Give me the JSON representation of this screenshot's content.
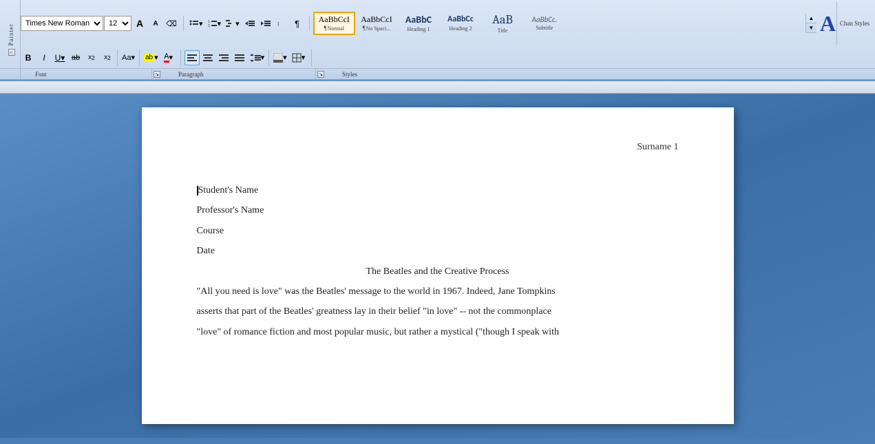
{
  "toolbar": {
    "font": {
      "name": "Times New Roman",
      "size": "12",
      "grow_label": "A",
      "shrink_label": "A",
      "clear_label": "⌫"
    },
    "formatting": {
      "bold": "B",
      "italic": "I",
      "underline": "U",
      "strikethrough": "ab",
      "subscript": "x₂",
      "superscript": "x²",
      "case": "Aa",
      "highlight_label": "ab",
      "color_label": "A"
    },
    "paragraph": {
      "list_bullets": "≡",
      "list_numbers": "≡",
      "multilevel": "≡",
      "decrease_indent": "⇐",
      "increase_indent": "⇒",
      "sort": "↕",
      "show_marks": "¶",
      "align_left": "≡",
      "align_center": "≡",
      "align_right": "≡",
      "align_justify": "≡",
      "line_spacing": "≡",
      "shading": "░",
      "borders": "⊞"
    },
    "styles": {
      "items": [
        {
          "id": "normal",
          "preview_top": "AaBbCcI",
          "preview_mark": "¶",
          "label": "Normal",
          "selected": true
        },
        {
          "id": "no-spacing",
          "preview_top": "AaBbCcI",
          "preview_mark": "¶",
          "label": "No Spaci...",
          "selected": false
        },
        {
          "id": "heading1",
          "preview_top": "AaBbC",
          "label": "Heading 1",
          "selected": false
        },
        {
          "id": "heading2",
          "preview_top": "AaBbCc",
          "label": "Heading 2",
          "selected": false
        },
        {
          "id": "title",
          "preview_top": "AaB",
          "label": "Title",
          "selected": false
        },
        {
          "id": "subtitle",
          "preview_top": "AaBbCc.",
          "label": "Subtitle",
          "selected": false
        }
      ]
    },
    "painter_label": "Painter",
    "font_section_label": "Font",
    "paragraph_section_label": "Paragraph",
    "styles_section_label": "Styles",
    "chan_styles_label": "Chan Styles"
  },
  "document": {
    "header_right": "Surname 1",
    "lines": [
      "Student's Name",
      "Professor's Name",
      "Course",
      "Date"
    ],
    "title": "The Beatles and the Creative Process",
    "paragraphs": [
      "\"All you need is love\" was the Beatles' message to the world in 1967. Indeed, Jane Tompkins",
      "asserts that part of the Beatles' greatness lay in their belief \"in love\"  -- not the commonplace",
      "\"love\" of romance fiction and most popular music, but rather a mystical (\"though I speak with"
    ]
  }
}
